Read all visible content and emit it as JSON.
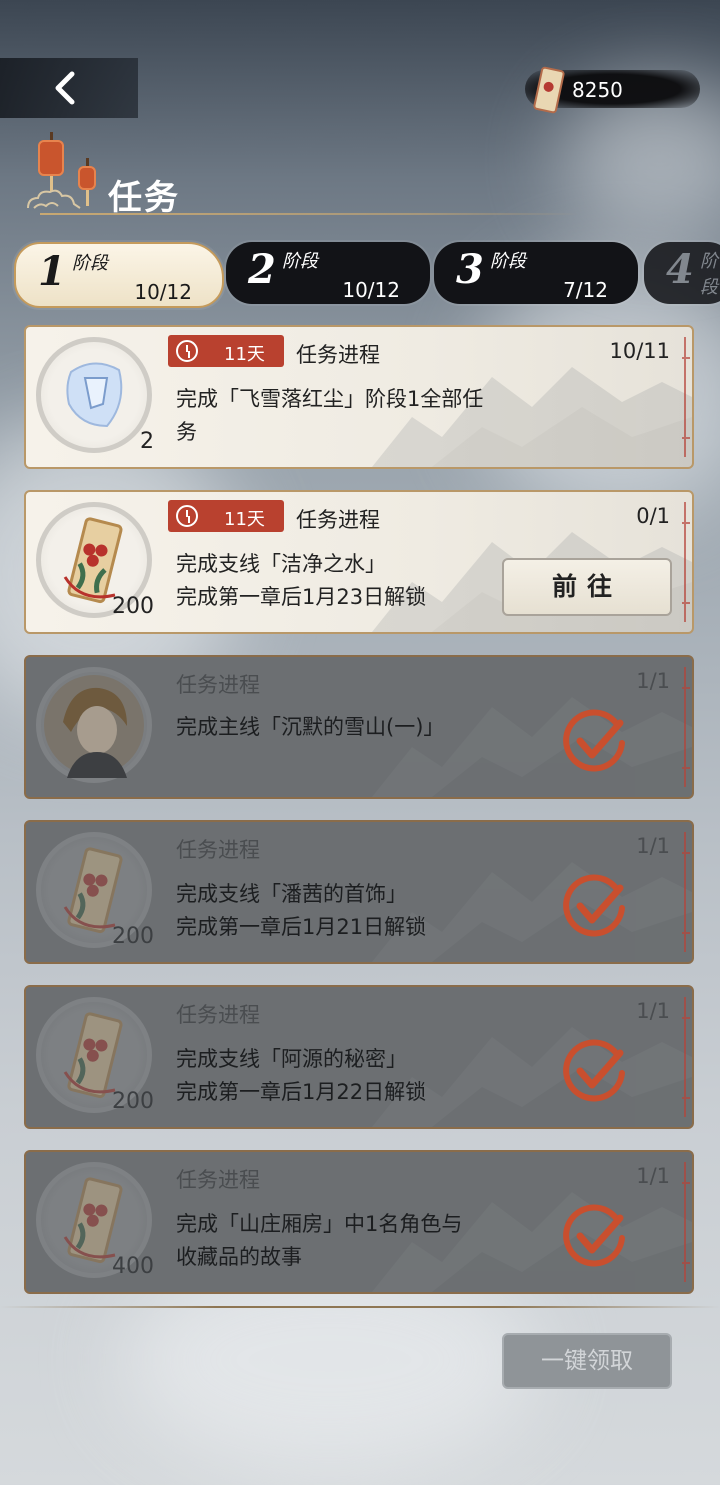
{
  "header": {
    "currency_amount": "8250",
    "title": "任务"
  },
  "stages": [
    {
      "num": "1",
      "label": "阶段",
      "count": "10/12",
      "active": true
    },
    {
      "num": "2",
      "label": "阶段",
      "count": "10/12"
    },
    {
      "num": "3",
      "label": "阶段",
      "count": "7/12"
    },
    {
      "num": "4",
      "label": "阶段",
      "count": ""
    }
  ],
  "tasks": [
    {
      "timer": "11天",
      "progress_label": "任务进程",
      "progress": "10/11",
      "desc": "完成「飞雪落红尘」阶段1全部任务",
      "reward_count": "2",
      "reward_icon": "gem-icon",
      "status": "in-progress"
    },
    {
      "timer": "11天",
      "progress_label": "任务进程",
      "progress": "0/1",
      "desc_line1": "完成支线「洁净之水」",
      "desc_line2": "完成第一章后1月23日解锁",
      "reward_count": "200",
      "reward_icon": "ticket-icon",
      "action": "前往",
      "status": "in-progress"
    },
    {
      "progress_label": "任务进程",
      "progress": "1/1",
      "desc_line1": "完成主线「沉默的雪山(一)」",
      "desc_line2": "",
      "reward_count": "",
      "reward_icon": "character-portrait-icon",
      "status": "completed"
    },
    {
      "progress_label": "任务进程",
      "progress": "1/1",
      "desc_line1": "完成支线「潘茜的首饰」",
      "desc_line2": "完成第一章后1月21日解锁",
      "reward_count": "200",
      "reward_icon": "ticket-icon",
      "status": "completed"
    },
    {
      "progress_label": "任务进程",
      "progress": "1/1",
      "desc_line1": "完成支线「阿源的秘密」",
      "desc_line2": "完成第一章后1月22日解锁",
      "reward_count": "200",
      "reward_icon": "ticket-icon",
      "status": "completed"
    },
    {
      "progress_label": "任务进程",
      "progress": "1/1",
      "desc_line1": "完成「山庄厢房」中1名角色与",
      "desc_line2": "收藏品的故事",
      "reward_count": "400",
      "reward_icon": "ticket-icon",
      "status": "completed"
    }
  ],
  "footer": {
    "claim_all_label": "一键领取"
  },
  "colors": {
    "accent": "#b9412f",
    "gold": "#c59b5c",
    "card_bg": "#f6f2ea",
    "done_bg": "#6c6f72"
  }
}
